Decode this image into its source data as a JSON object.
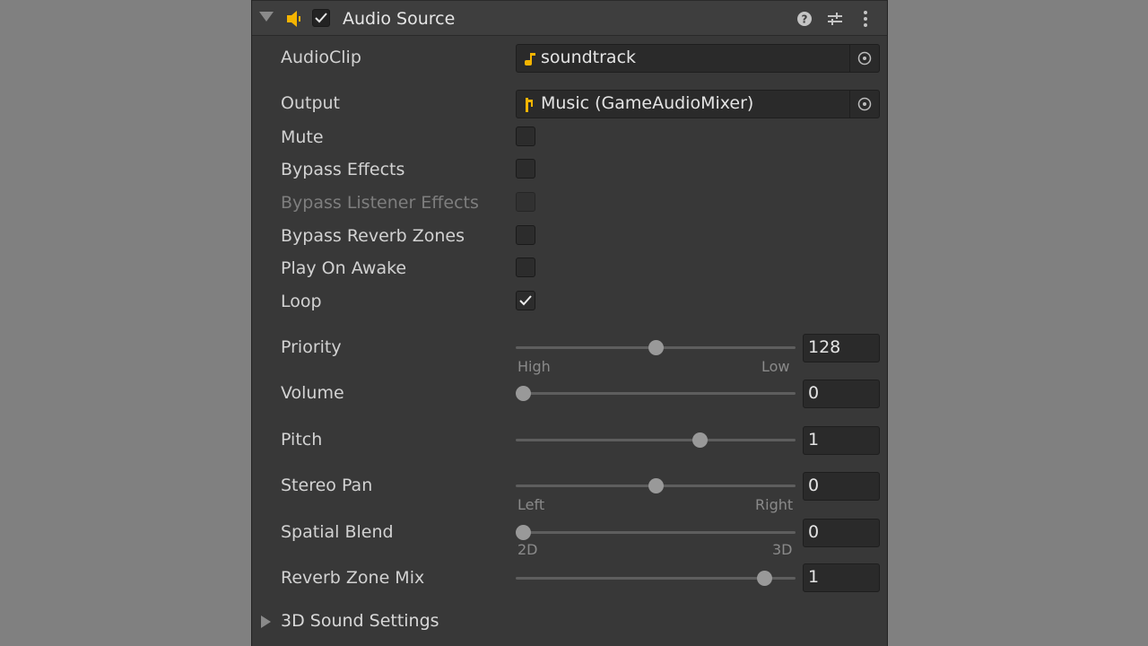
{
  "component": {
    "title": "Audio Source",
    "enabled": true,
    "icons": [
      "help-icon",
      "preset-icon",
      "more-menu-icon"
    ]
  },
  "fields": {
    "audio_clip": {
      "label": "AudioClip",
      "value": "soundtrack"
    },
    "output": {
      "label": "Output",
      "value": "Music (GameAudioMixer)"
    },
    "mute": {
      "label": "Mute",
      "checked": false
    },
    "bypass_effects": {
      "label": "Bypass Effects",
      "checked": false
    },
    "bypass_listener_effects": {
      "label": "Bypass Listener Effects",
      "checked": false,
      "disabled": true
    },
    "bypass_reverb_zones": {
      "label": "Bypass Reverb Zones",
      "checked": false
    },
    "play_on_awake": {
      "label": "Play On Awake",
      "checked": false
    },
    "loop": {
      "label": "Loop",
      "checked": true
    },
    "priority": {
      "label": "Priority",
      "value": "128",
      "min": 0,
      "max": 256,
      "min_label": "High",
      "max_label": "Low"
    },
    "volume": {
      "label": "Volume",
      "value": "0",
      "min": 0,
      "max": 1
    },
    "pitch": {
      "label": "Pitch",
      "value": "1",
      "min": -3,
      "max": 3
    },
    "stereo_pan": {
      "label": "Stereo Pan",
      "value": "0",
      "min": -1,
      "max": 1,
      "min_label": "Left",
      "max_label": "Right"
    },
    "spatial_blend": {
      "label": "Spatial Blend",
      "value": "0",
      "min": 0,
      "max": 1,
      "min_label": "2D",
      "max_label": "3D"
    },
    "reverb_zone_mix": {
      "label": "Reverb Zone Mix",
      "value": "1",
      "min": 0,
      "max": 1.1
    }
  },
  "sections": {
    "sound_settings": {
      "label": "3D Sound Settings",
      "expanded": false
    }
  },
  "colors": {
    "accent": "#f4b400",
    "panel_bg": "#383838"
  }
}
